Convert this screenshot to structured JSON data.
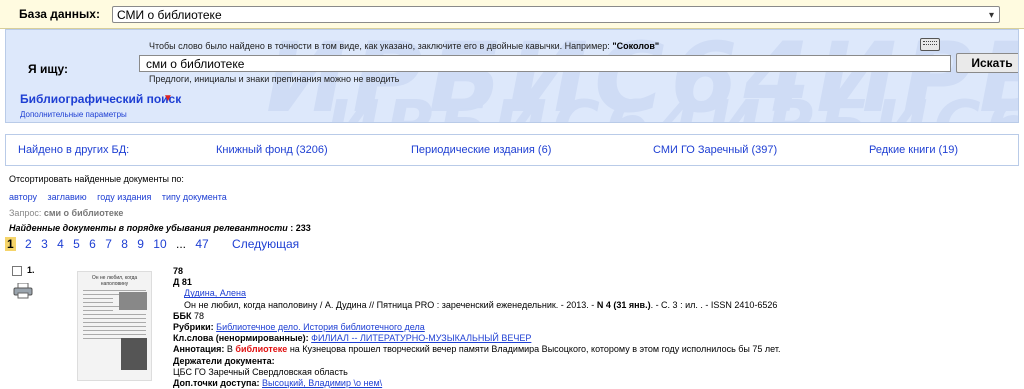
{
  "db": {
    "label": "База данных:",
    "selected": "СМИ о библиотеке"
  },
  "search": {
    "hint_prefix": "Чтобы слово было найдено в точности в том виде, как указано, заключите его в двойные кавычки. Например:",
    "hint_example": "\"Соколов\"",
    "label": "Я ищу:",
    "query": "сми о библиотеке",
    "button": "Искать",
    "subhint": "Предлоги, инициалы и знаки препинания можно не вводить",
    "biblio_link": "Библиографический поиск",
    "extra_link": "Дополнительные параметры",
    "watermark": "ИРБИС64ИРБИС64",
    "watermark2": "ИРБИС64ИРБИС64"
  },
  "other_dbs": {
    "label": "Найдено в других БД:",
    "items": [
      "Книжный фонд (3206)",
      "Периодические издания (6)",
      "СМИ ГО Заречный (397)",
      "Редкие книги (19)"
    ]
  },
  "sort": {
    "label": "Отсортировать найденные документы по:",
    "options": [
      "автору",
      "заглавию",
      "году издания",
      "типу документа"
    ]
  },
  "request": {
    "label": "Запрос:",
    "value": "сми о библиотеке"
  },
  "found": {
    "label": "Найденные документы в порядке убывания релевантности",
    "count": ": 233"
  },
  "pager": {
    "current": "1",
    "pages": [
      "2",
      "3",
      "4",
      "5",
      "6",
      "7",
      "8",
      "9",
      "10"
    ],
    "dots": "...",
    "last": "47",
    "next": "Следующая"
  },
  "record": {
    "number": "1.",
    "thumb_title": "Он не любил, когда наполовину",
    "code1": "78",
    "code2": "Д 81",
    "author": "Дудина, Алена",
    "desc_a": "Он не любил, когда наполовину / А. Дудина // Пятница PRO : зареченский еженедельник. - 2013. -",
    "desc_b": "N 4 (31 янв.)",
    "desc_c": ". - С. 3 : ил. . - ISSN 2410-6526",
    "bbk_label": "ББК",
    "bbk_value": "78",
    "rubrics_label": "Рубрики:",
    "rubrics_value": "Библиотечное дело. История библиотечного дела",
    "kw_label": "Кл.слова (ненормированные):",
    "kw_value": "ФИЛИАЛ -- ЛИТЕРАТУРНО-МУЗЫКАЛЬНЫЙ ВЕЧЕР",
    "annot_label": "Аннотация:",
    "annot_a": "В",
    "annot_hl": "библиотеке",
    "annot_b": "на Кузнецова прошел творческий вечер памяти Владимира Высоцкого, которому в этом году исполнилось бы 75 лет.",
    "holders_label": "Держатели документа:",
    "holders_value": "ЦБС ГО Заречный Свердловская область",
    "access_label": "Доп.точки доступа:",
    "access_value": "Высоцкий, Владимир \\о нем\\"
  }
}
